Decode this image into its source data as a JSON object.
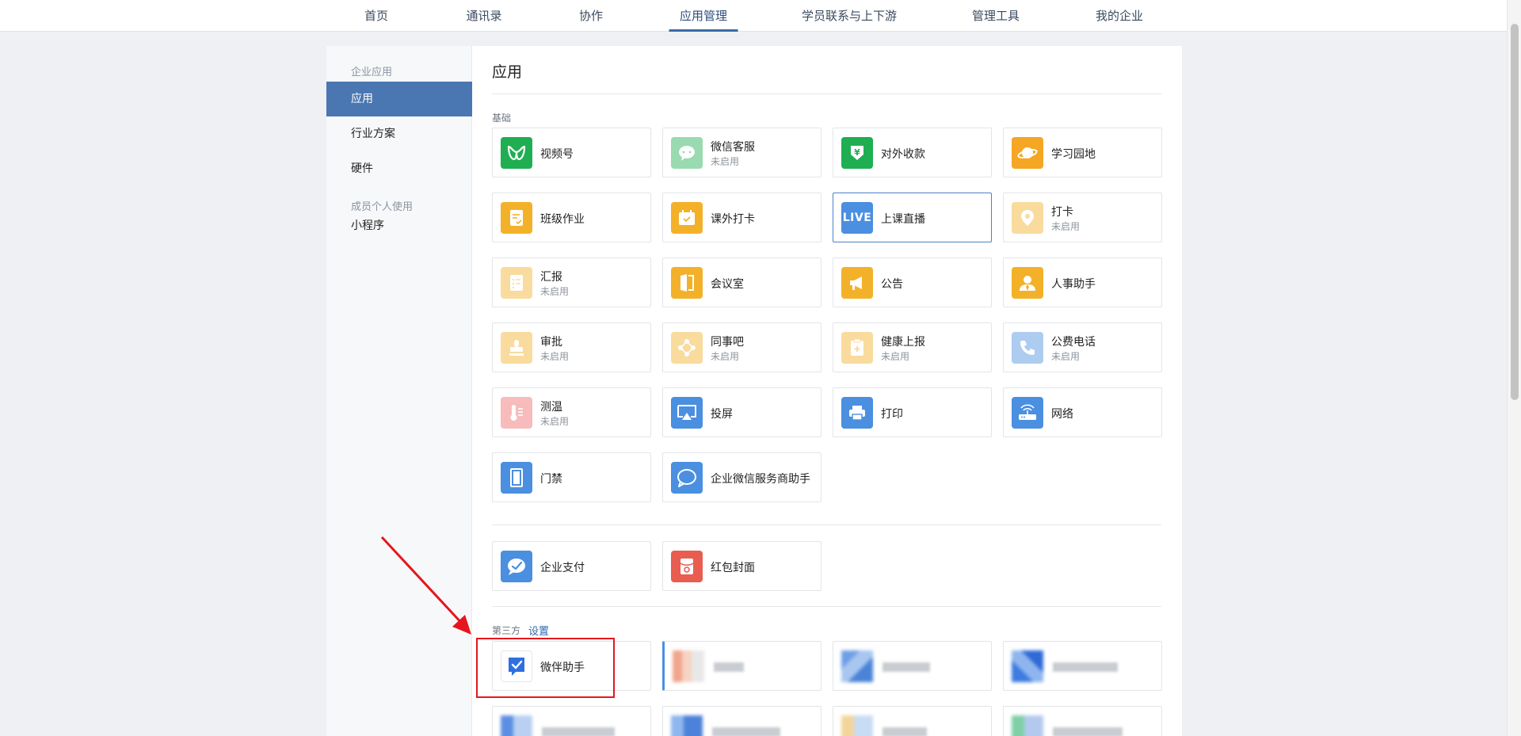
{
  "topnav": {
    "tabs": [
      {
        "label": "首页"
      },
      {
        "label": "通讯录"
      },
      {
        "label": "协作"
      },
      {
        "label": "应用管理",
        "active": true
      },
      {
        "label": "学员联系与上下游"
      },
      {
        "label": "管理工具"
      },
      {
        "label": "我的企业"
      }
    ]
  },
  "sidebar": {
    "group1": "企业应用",
    "items": [
      {
        "label": "应用",
        "active": true
      },
      {
        "label": "行业方案"
      },
      {
        "label": "硬件"
      }
    ],
    "group2": "成员个人使用",
    "items2": [
      {
        "label": "小程序"
      }
    ]
  },
  "content": {
    "title": "应用",
    "basic_label": "基础",
    "third_party_label": "第三方",
    "third_party_settings": "设置",
    "status_disabled": "未启用",
    "apps": [
      {
        "name": "视频号",
        "icon": "channels-icon",
        "color": "#1fae52"
      },
      {
        "name": "微信客服",
        "status": "未启用",
        "icon": "wechat-service-icon",
        "color": "#1fae52"
      },
      {
        "name": "对外收款",
        "icon": "payment-receive-icon",
        "color": "#1fae52"
      },
      {
        "name": "学习园地",
        "icon": "planet-icon",
        "color": "#f5a623"
      },
      {
        "name": "班级作业",
        "icon": "homework-icon",
        "color": "#f3b12a"
      },
      {
        "name": "课外打卡",
        "icon": "checkin-calendar-icon",
        "color": "#f3b12a"
      },
      {
        "name": "上课直播",
        "icon": "live-icon",
        "color": "#4b8fe0"
      },
      {
        "name": "打卡",
        "status": "未启用",
        "icon": "location-pin-icon",
        "color": "#f3b12a"
      },
      {
        "name": "汇报",
        "status": "未启用",
        "icon": "report-icon",
        "color": "#f3b12a"
      },
      {
        "name": "会议室",
        "icon": "meeting-room-icon",
        "color": "#f3b12a"
      },
      {
        "name": "公告",
        "icon": "megaphone-icon",
        "color": "#f3b12a"
      },
      {
        "name": "人事助手",
        "icon": "hr-person-icon",
        "color": "#f3b12a"
      },
      {
        "name": "审批",
        "status": "未启用",
        "icon": "stamp-icon",
        "color": "#f3b12a"
      },
      {
        "name": "同事吧",
        "status": "未启用",
        "icon": "colleague-forum-icon",
        "color": "#f3b12a"
      },
      {
        "name": "健康上报",
        "status": "未启用",
        "icon": "health-report-icon",
        "color": "#f3b12a"
      },
      {
        "name": "公费电话",
        "status": "未启用",
        "icon": "phone-icon",
        "color": "#4b8fe0"
      },
      {
        "name": "测温",
        "status": "未启用",
        "icon": "thermometer-icon",
        "color": "#ee6b6b"
      },
      {
        "name": "投屏",
        "icon": "screen-cast-icon",
        "color": "#4b8fe0"
      },
      {
        "name": "打印",
        "icon": "printer-icon",
        "color": "#4b8fe0"
      },
      {
        "name": "网络",
        "icon": "router-icon",
        "color": "#4b8fe0"
      },
      {
        "name": "门禁",
        "icon": "door-icon",
        "color": "#4b8fe0"
      },
      {
        "name": "企业微信服务商助手",
        "icon": "service-chat-icon",
        "color": "#4b8fe0"
      }
    ],
    "pay_apps": [
      {
        "name": "企业支付",
        "icon": "enterprise-pay-icon",
        "color": "#4b8fe0"
      },
      {
        "name": "红包封面",
        "icon": "red-packet-icon",
        "color": "#e85d4f"
      }
    ],
    "third_party_apps": [
      {
        "name": "微伴助手",
        "icon": "check-badge-icon",
        "color": "#2f6fe0"
      }
    ]
  }
}
